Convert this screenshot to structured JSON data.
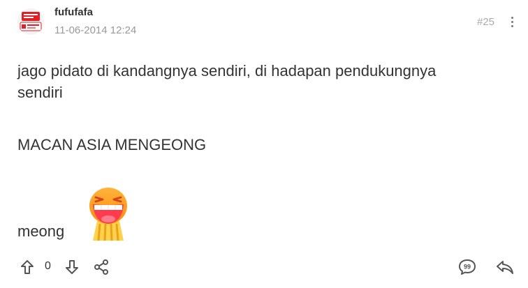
{
  "post": {
    "username": "fufufafa",
    "timestamp": "11-06-2014 12:24",
    "number": "#25",
    "avatar_label": "avatar",
    "content": {
      "line1": "jago pidato di kandangnya sendiri, di hadapan pendukungnya",
      "line2": "sendiri",
      "line3": "MACAN ASIA MENGEONG",
      "line4": "meong"
    },
    "emoji": "laughing-emoji"
  },
  "actions": {
    "vote_count": "0",
    "icons": [
      "upvote-icon",
      "downvote-icon",
      "share-icon",
      "quote-icon",
      "reply-icon"
    ]
  },
  "colors": {
    "text": "#333333",
    "muted": "#999999",
    "avatar_brand": "#e31e24",
    "emoji_face": "#ff9a1f"
  }
}
